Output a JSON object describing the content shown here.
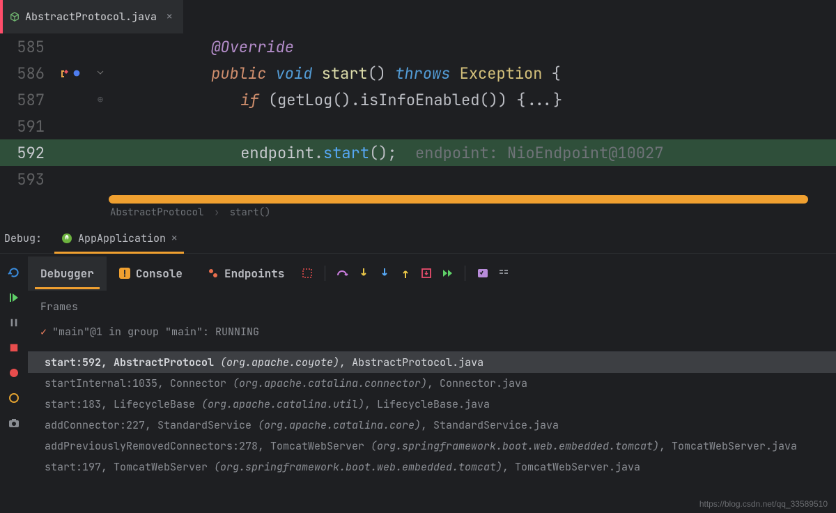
{
  "tab": {
    "filename": "AbstractProtocol.java"
  },
  "editor": {
    "lines": {
      "l585": "585",
      "l586": "586",
      "l587": "587",
      "l591": "591",
      "l592": "592",
      "l593": "593"
    },
    "override": "@Override",
    "kw_public": "public",
    "kw_void": "void",
    "fn_start": "start",
    "parens": "()",
    "kw_throws": "throws",
    "type_exception": "Exception",
    "brace_open": "{",
    "kw_if": "if",
    "fn_getlog": "(getLog().isInfoEnabled())",
    "fold_body": "{...}",
    "endpoint_var": "endpoint",
    "endpoint_dot": ".",
    "endpoint_call": "start",
    "endpoint_paren": "();",
    "hint": "endpoint: NioEndpoint@10027",
    "breadcrumb_cls": "AbstractProtocol",
    "breadcrumb_fn": "start()"
  },
  "debug": {
    "label": "Debug:",
    "app": "AppApplication",
    "tabs": {
      "debugger": "Debugger",
      "console": "Console",
      "endpoints": "Endpoints"
    },
    "frames_label": "Frames",
    "thread": "\"main\"@1 in group \"main\": RUNNING",
    "stack": [
      {
        "method": "start",
        "line": "592",
        "class": "AbstractProtocol",
        "pkg": "(org.apache.coyote)",
        "file": "AbstractProtocol.java",
        "sel": true
      },
      {
        "method": "startInternal",
        "line": "1035",
        "class": "Connector",
        "pkg": "(org.apache.catalina.connector)",
        "file": "Connector.java"
      },
      {
        "method": "start",
        "line": "183",
        "class": "LifecycleBase",
        "pkg": "(org.apache.catalina.util)",
        "file": "LifecycleBase.java"
      },
      {
        "method": "addConnector",
        "line": "227",
        "class": "StandardService",
        "pkg": "(org.apache.catalina.core)",
        "file": "StandardService.java"
      },
      {
        "method": "addPreviouslyRemovedConnectors",
        "line": "278",
        "class": "TomcatWebServer",
        "pkg": "(org.springframework.boot.web.embedded.tomcat)",
        "file": "TomcatWebServer.java"
      },
      {
        "method": "start",
        "line": "197",
        "class": "TomcatWebServer",
        "pkg": "(org.springframework.boot.web.embedded.tomcat)",
        "file": "TomcatWebServer.java"
      }
    ]
  },
  "watermark": "https://blog.csdn.net/qq_33589510"
}
